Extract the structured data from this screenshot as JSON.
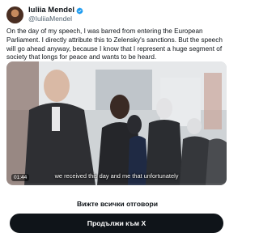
{
  "author": {
    "display_name": "Iuliia Mendel",
    "handle": "@IuliiaMendel",
    "avatar_icon": "user-avatar",
    "verified_icon": "verified-badge-icon",
    "verified_color": "#1d9bf0"
  },
  "tweet": {
    "text": "On the day of my speech, I was barred from entering the European Parliament. I directly attribute this to Zelensky's sanctions. But the speech will go ahead anyway, because I know that I represent a huge segment of society that longs for peace and wants to be heard."
  },
  "video": {
    "timestamp": "01:44",
    "caption": "we received this day and me that unfortunately"
  },
  "footer": {
    "see_all_replies": "Вижте всички отговори",
    "continue_button": "Продължи към X",
    "button_color": "#0f1419"
  }
}
